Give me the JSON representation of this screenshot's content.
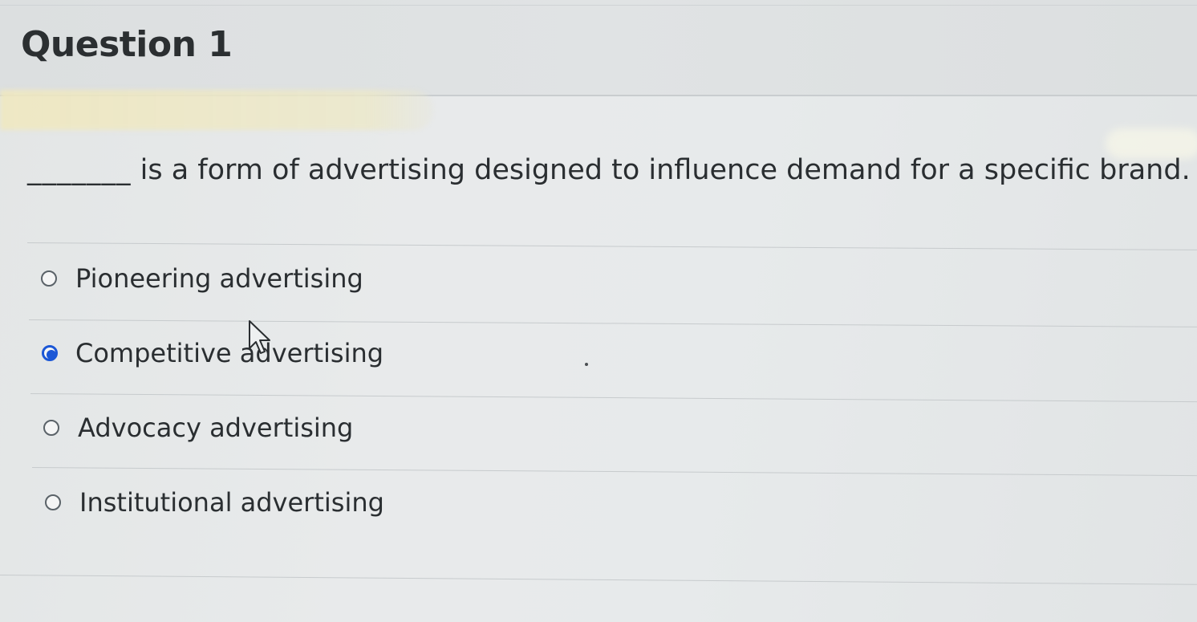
{
  "question": {
    "title": "Question 1",
    "blank": "_______",
    "text": "is a form of advertising designed to influence demand for a specific brand."
  },
  "answers": [
    {
      "label": "Pioneering advertising",
      "selected": false
    },
    {
      "label": "Competitive advertising",
      "selected": true
    },
    {
      "label": "Advocacy advertising",
      "selected": false
    },
    {
      "label": "Institutional advertising",
      "selected": false
    }
  ],
  "colors": {
    "selected_radio": "#1b57d6",
    "text": "#2a2e31",
    "background": "#e6e9ea"
  },
  "icons": {
    "pointer": "mouse-pointer-icon"
  }
}
